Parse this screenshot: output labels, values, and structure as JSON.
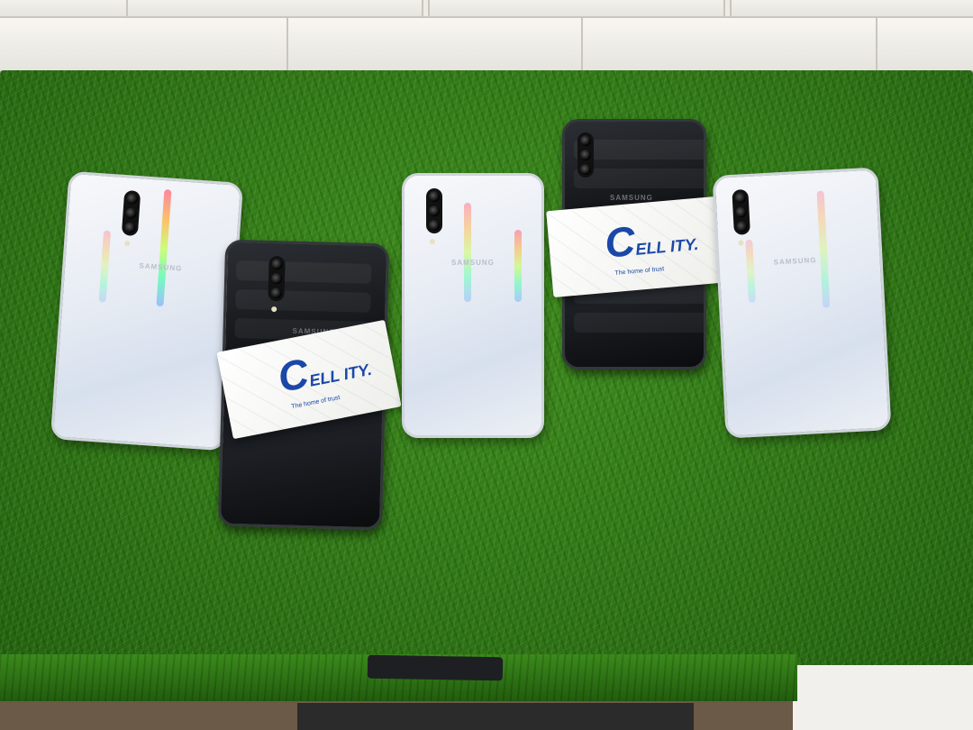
{
  "scene": {
    "description_subjects": [
      "smartphone-back-white",
      "smartphone-back-black"
    ],
    "colors": {
      "grass": "#2f7516",
      "wall": "#ecebe6",
      "logo_blue": "#1a48a8"
    }
  },
  "phones": [
    {
      "color": "white",
      "brand": "SAMSUNG"
    },
    {
      "color": "black",
      "brand": "SAMSUNG"
    },
    {
      "color": "white",
      "brand": "SAMSUNG"
    },
    {
      "color": "black",
      "brand": "SAMSUNG"
    },
    {
      "color": "white",
      "brand": "SAMSUNG"
    }
  ],
  "cards": [
    {
      "logo_c": "C",
      "logo_rest": "ELL ITY.",
      "tagline": "The home of trust"
    },
    {
      "logo_c": "C",
      "logo_rest": "ELL ITY.",
      "tagline": "The home of trust"
    }
  ]
}
